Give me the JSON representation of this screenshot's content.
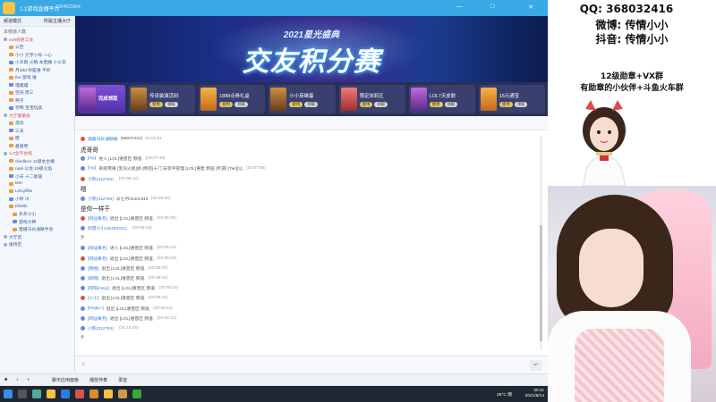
{
  "window": {
    "title": "1.1游戏直播平台",
    "subtitle": "1254621654",
    "controls": [
      "—",
      "□",
      "✕"
    ]
  },
  "left_panel": {
    "tabs": [
      "频道模式",
      "所属主播大厅"
    ],
    "subheader": "本频道人数",
    "items": [
      {
        "label": "549规矩工会",
        "level": 0,
        "style": "red"
      },
      {
        "label": "公告",
        "level": 1
      },
      {
        "label": "小小 元亨小号 一心",
        "level": 1
      },
      {
        "label": "小天鹅 火锅 本直播 小火花",
        "level": 1
      },
      {
        "label": "月ddd 你是谁 不好",
        "level": 1
      },
      {
        "label": "fire 游戏 谁",
        "level": 1
      },
      {
        "label": "喵喵喵",
        "level": 1
      },
      {
        "label": "空间 周三",
        "level": 1
      },
      {
        "label": "鸭子",
        "level": 1
      },
      {
        "label": "奈鸭 宝宝玩具",
        "level": 1
      },
      {
        "label": "大厅集散处",
        "level": 0,
        "style": "red"
      },
      {
        "label": "游兵",
        "level": 1
      },
      {
        "label": "三夫",
        "level": 1
      },
      {
        "label": "唐",
        "level": 1
      },
      {
        "label": "盘基吧",
        "level": 1
      },
      {
        "label": "1.0全平台组",
        "level": 0,
        "style": "red"
      },
      {
        "label": "cliedlecc 11级女主播",
        "level": 1
      },
      {
        "label": "nepi 公会 15级火焰",
        "level": 1
      },
      {
        "label": "小天 十二星座",
        "level": 1
      },
      {
        "label": "test",
        "level": 1
      },
      {
        "label": "LOLyllllie",
        "level": 1
      },
      {
        "label": "小铃 冷",
        "level": 1
      },
      {
        "label": "Dhello",
        "level": 1
      },
      {
        "label": "多多小小",
        "level": 2
      },
      {
        "label": "游戏大神",
        "level": 2
      },
      {
        "label": "直播马长通联手会",
        "level": 2
      },
      {
        "label": "大厅区",
        "level": 0
      },
      {
        "label": "接待区",
        "level": 0
      }
    ]
  },
  "banner": {
    "top_text": "2021星光盛典",
    "main_text": "交友积分赛"
  },
  "gifts": [
    {
      "label": "完成领取",
      "btns": []
    },
    {
      "label": "传说装激活码",
      "btns": [
        "使用",
        "领取"
      ]
    },
    {
      "label": "1888点券礼盒",
      "btns": [
        "使用",
        "领取"
      ]
    },
    {
      "label": "小小英雄蛋",
      "btns": [
        "使用",
        "领取"
      ]
    },
    {
      "label": "限定炫彩区",
      "btns": [
        "使用",
        "领取"
      ]
    },
    {
      "label": "LOL7天皮肤",
      "btns": [
        "使用",
        "领取"
      ]
    },
    {
      "label": "15元通宝",
      "btns": [
        "使用",
        "领取"
      ]
    }
  ],
  "chat": {
    "messages": [
      {
        "type": "sys",
        "user": "纸股马长通联联",
        "text": "(55047421)",
        "time": "20:01:51"
      },
      {
        "type": "big",
        "text": "虎哥哥"
      },
      {
        "type": "sys",
        "user": "[rvp]",
        "text": "进入 [LOL]语音区 频道.",
        "time": "(20:07:48)"
      },
      {
        "type": "sys",
        "user": "[rvp]",
        "text": "系统用语 [宝马火星]进 [绝招]十门 安装平管理 [LOL]语音 频道 [手游] [Tier][1].",
        "time": "(20:07:56)"
      },
      {
        "type": "sys",
        "user": "小熊(312784)",
        "text": "",
        "time": "(20:08:12)"
      },
      {
        "type": "big",
        "text": "嗯"
      },
      {
        "type": "sys",
        "user": "小熊(312784)",
        "text": "@七月44401319",
        "time": "(20:09:02)"
      },
      {
        "type": "big",
        "text": "是你一样干"
      },
      {
        "type": "sys",
        "user": "[同仙事务]",
        "text": "退出 [LOL]语音区 频道.",
        "time": "(20:05:28)"
      },
      {
        "type": "sys",
        "user": "仰望小小(45480321)",
        "text": "",
        "time": "(20:06:13)"
      },
      {
        "type": "big",
        "text": "?"
      },
      {
        "type": "sys",
        "user": "[同仙事务]",
        "text": "进入 [LOL]语音区 频道.",
        "time": "(20:05:34)"
      },
      {
        "type": "sys",
        "user": "[同仙事务]",
        "text": "退出 [LOL]语音区 频道.",
        "time": "(20:08:03)"
      },
      {
        "type": "sys",
        "user": "[网络]",
        "text": "退出 [LOL]语音区 频道.",
        "time": "(20:08:07)"
      },
      {
        "type": "sys",
        "user": "[新网]",
        "text": "退出 [LOL]语音区 频道.",
        "time": "(20:08:10)"
      },
      {
        "type": "sys",
        "user": "[阿阳(Hey)]",
        "text": "退出 [LOL]语音区 频道.",
        "time": "(20:08:13)"
      },
      {
        "type": "sys",
        "user": "[小小]",
        "text": "退出 [LOL]语音区 频道.",
        "time": "(20:08:16)"
      },
      {
        "type": "sys",
        "user": "[kingly~]",
        "text": "退出 [LOL]语音区 频道.",
        "time": "(20:08:22)"
      },
      {
        "type": "sys",
        "user": "[同仙事务]",
        "text": "退出 [LOL]语音区 频道.",
        "time": "(20:08:31)"
      },
      {
        "type": "sys",
        "user": "小熊(312784)",
        "text": "",
        "time": "(20:10:28)"
      },
      {
        "type": "big",
        "text": "?"
      }
    ]
  },
  "input": {
    "placeholder": "",
    "send_icon": "↵"
  },
  "bottom_tools": [
    "聊天应用面板",
    "播放伴奏",
    "录音"
  ],
  "taskbar": {
    "tray": "25°C 雨",
    "time": "20:11",
    "date": "2021/8/14"
  },
  "streamer": {
    "qq": "QQ: 368032416",
    "weibo": "微博: 传情小小",
    "douyin": "抖音: 传情小小",
    "group1": "12级勋章+VX群",
    "group2": "有勋章的小伙伴+斗鱼火车群"
  }
}
